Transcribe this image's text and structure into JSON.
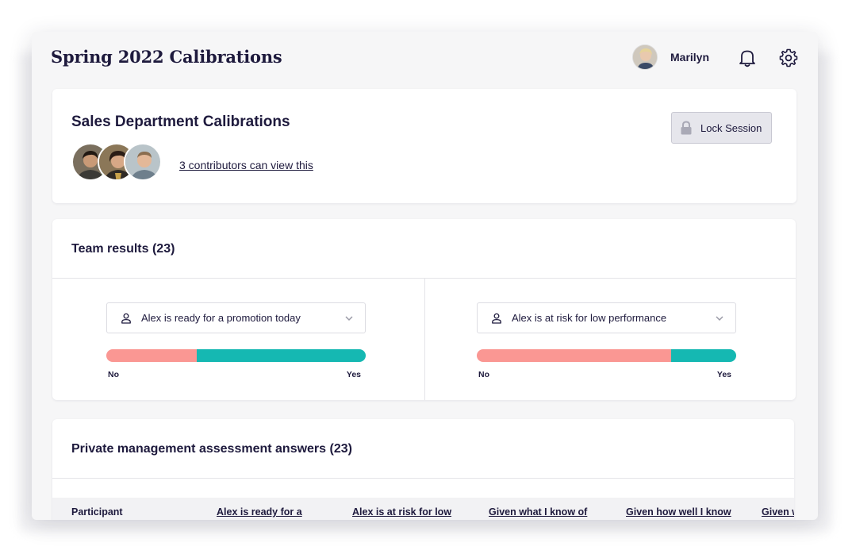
{
  "app": {
    "title": "Spring 2022 Calibrations",
    "user_name": "Marilyn"
  },
  "session": {
    "title": "Sales Department Calibrations",
    "contributors_link": "3 contributors can view this",
    "lock_button": "Lock Session"
  },
  "team_results": {
    "title": "Team results (23)",
    "questions": [
      {
        "label": "Alex is ready for a promotion today",
        "no_fraction": 0.35,
        "no_label": "No",
        "yes_label": "Yes"
      },
      {
        "label": "Alex is at risk for low performance",
        "no_fraction": 0.75,
        "no_label": "No",
        "yes_label": "Yes"
      }
    ]
  },
  "private_answers": {
    "title": "Private  management assessment answers (23)",
    "columns": [
      "Participant",
      "Alex is ready for a",
      "Alex is at risk for low",
      "Given what I know of",
      "Given how well I know",
      "Given w"
    ]
  },
  "colors": {
    "no": "#fa9793",
    "yes": "#15b8b2",
    "text": "#1e1a3d"
  },
  "icons": [
    "bell-icon",
    "gear-icon",
    "lock-icon",
    "person-icon",
    "chevron-down-icon"
  ]
}
